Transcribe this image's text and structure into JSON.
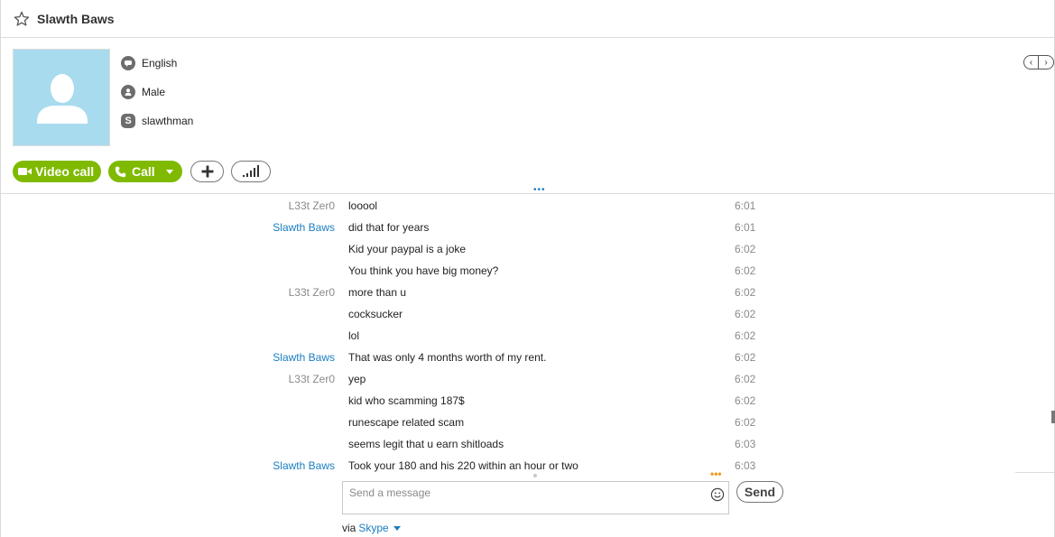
{
  "header": {
    "contact_name": "Slawth Baws"
  },
  "profile": {
    "language": "English",
    "gender": "Male",
    "skype_name": "slawthman"
  },
  "actions": {
    "video_call_label": "Video call",
    "call_label": "Call"
  },
  "messages": [
    {
      "sender": "L33t Zer0",
      "sender_type": "other",
      "text": "looool",
      "time": "6:01"
    },
    {
      "sender": "Slawth Baws",
      "sender_type": "self",
      "text": "did that for years",
      "time": "6:01"
    },
    {
      "sender": "",
      "sender_type": "self",
      "text": "Kid your paypal is a joke",
      "time": "6:02"
    },
    {
      "sender": "",
      "sender_type": "self",
      "text": "You think you have big money?",
      "time": "6:02"
    },
    {
      "sender": "L33t Zer0",
      "sender_type": "other",
      "text": "more than u",
      "time": "6:02"
    },
    {
      "sender": "",
      "sender_type": "other",
      "text": "cocksucker",
      "time": "6:02"
    },
    {
      "sender": "",
      "sender_type": "other",
      "text": "lol",
      "time": "6:02"
    },
    {
      "sender": "Slawth Baws",
      "sender_type": "self",
      "text": "That was only 4 months worth of my rent.",
      "time": "6:02"
    },
    {
      "sender": "L33t Zer0",
      "sender_type": "other",
      "text": "yep",
      "time": "6:02"
    },
    {
      "sender": "",
      "sender_type": "other",
      "text": "kid who scamming 187$",
      "time": "6:02"
    },
    {
      "sender": "",
      "sender_type": "other",
      "text": "runescape related scam",
      "time": "6:02"
    },
    {
      "sender": "",
      "sender_type": "other",
      "text": "seems legit that u earn shitloads",
      "time": "6:03"
    },
    {
      "sender": "Slawth Baws",
      "sender_type": "self",
      "text": "Took your 180 and his 220 within an hour or two",
      "time": "6:03"
    }
  ],
  "compose": {
    "placeholder": "Send a message",
    "value": "",
    "send_label": "Send",
    "via_prefix": "via",
    "via_service": "Skype"
  },
  "colors": {
    "accent_blue": "#1a7ec2",
    "call_green": "#7fba00",
    "avatar_bg": "#a9dbee",
    "typing_orange": "#f29a1c"
  }
}
